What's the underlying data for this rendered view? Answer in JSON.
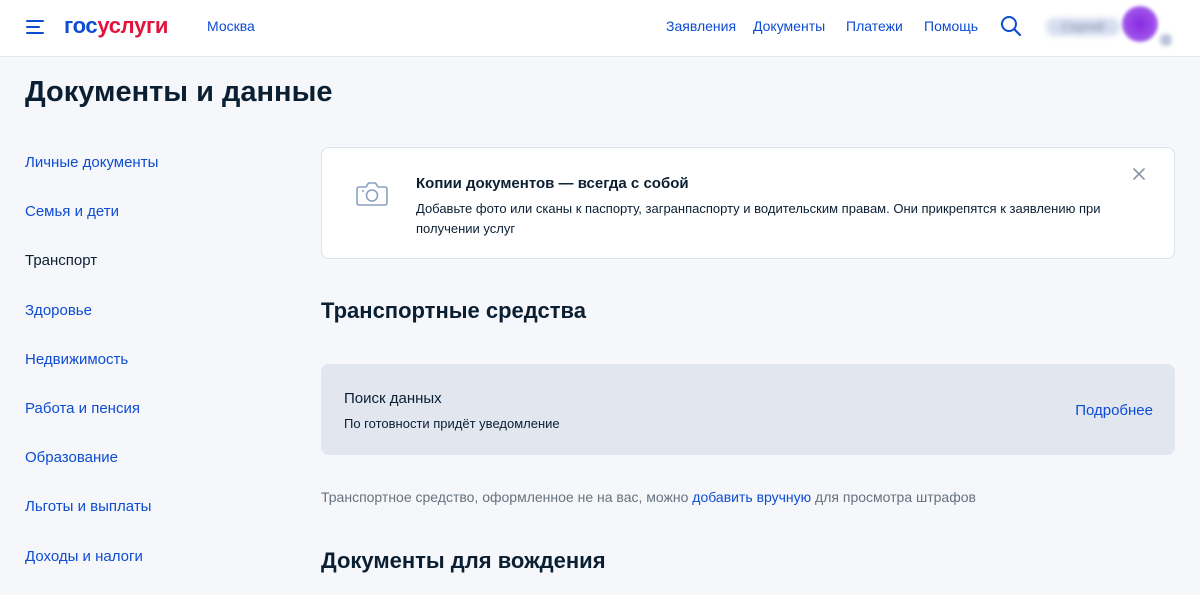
{
  "header": {
    "logo_part1": "гос",
    "logo_part2": "услуги",
    "city": "Москва",
    "nav": [
      {
        "label": "Заявления"
      },
      {
        "label": "Документы"
      },
      {
        "label": "Платежи"
      },
      {
        "label": "Помощь"
      }
    ],
    "user_name": "Сергей"
  },
  "page": {
    "title": "Документы и данные"
  },
  "sidebar": {
    "items": [
      {
        "label": "Личные документы"
      },
      {
        "label": "Семья и дети"
      },
      {
        "label": "Транспорт",
        "active": true
      },
      {
        "label": "Здоровье"
      },
      {
        "label": "Недвижимость"
      },
      {
        "label": "Работа и пенсия"
      },
      {
        "label": "Образование"
      },
      {
        "label": "Льготы и выплаты"
      },
      {
        "label": "Доходы и налоги"
      }
    ]
  },
  "info_card": {
    "icon": "camera-icon",
    "title": "Копии документов — всегда с собой",
    "text": "Добавьте фото или сканы к паспорту, загранпаспорту и водительским правам. Они прикрепятся к заявлению при получении услуг"
  },
  "vehicles": {
    "title": "Транспортные средства",
    "search_title": "Поиск данных",
    "search_subtitle": "По готовности придёт уведомление",
    "more_label": "Подробнее",
    "note_before": "Транспортное средство, оформленное не на вас, можно ",
    "note_link": "добавить вручную",
    "note_after": " для просмотра штрафов"
  },
  "driving": {
    "title": "Документы для вождения"
  },
  "colors": {
    "accent": "#0d4cd3",
    "logo_red": "#e3143c",
    "text": "#0b1f33",
    "muted": "#66727f",
    "background": "#f5f7fa",
    "status_card": "#e1e6ef"
  }
}
